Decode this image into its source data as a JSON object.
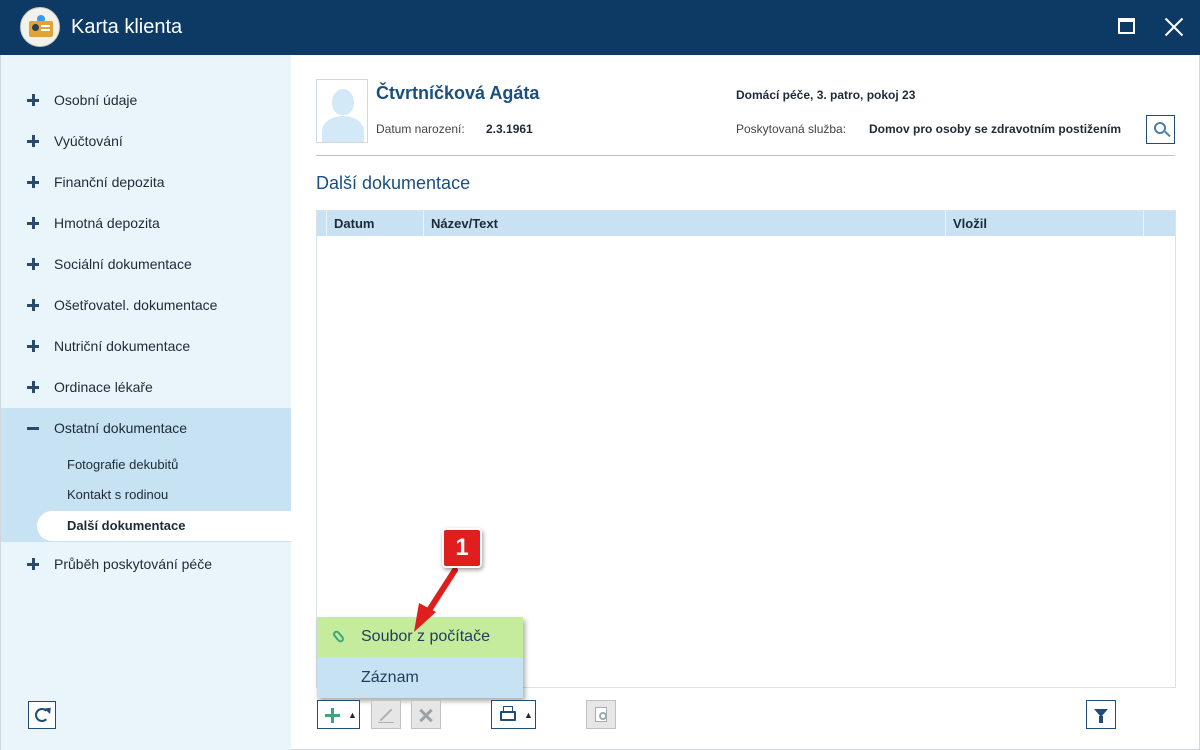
{
  "window": {
    "title": "Karta klienta"
  },
  "sidebar": {
    "items": [
      {
        "label": "Osobní údaje"
      },
      {
        "label": "Vyúčtování"
      },
      {
        "label": "Finanční depozita"
      },
      {
        "label": "Hmotná depozita"
      },
      {
        "label": "Sociální dokumentace"
      },
      {
        "label": "Ošetřovatel. dokumentace"
      },
      {
        "label": "Nutriční dokumentace"
      },
      {
        "label": "Ordinace lékaře"
      },
      {
        "label": "Ostatní dokumentace"
      },
      {
        "label": "Průběh poskytování péče"
      }
    ],
    "subitems": [
      {
        "label": "Fotografie dekubitů"
      },
      {
        "label": "Kontakt s rodinou"
      },
      {
        "label": "Další dokumentace"
      }
    ]
  },
  "client": {
    "name": "Čtvrtníčková Agáta",
    "birth_label": "Datum narození:",
    "birth_date": "2.3.1961",
    "location": "Domácí péče, 3. patro, pokoj 23",
    "service_label": "Poskytovaná služba:",
    "service_value": "Domov pro osoby se zdravotním postižením"
  },
  "section": {
    "title": "Další dokumentace"
  },
  "grid": {
    "columns": [
      "Datum",
      "Název/Text",
      "Vložil"
    ]
  },
  "popup_menu": {
    "items": [
      {
        "label": "Soubor z počítače"
      },
      {
        "label": "Záznam"
      }
    ]
  },
  "callout": {
    "number": "1"
  },
  "colors": {
    "titlebar": "#0d3a64",
    "sidebar_bg": "#eaf4fb",
    "accent": "#1b4f80",
    "highlight_green": "#c4ec9c",
    "callout_red": "#e01e1e"
  },
  "icons": {
    "app": "client-card-icon",
    "add": "plus-icon",
    "edit": "pencil-icon",
    "delete": "x-icon",
    "print": "printer-icon",
    "preview": "print-preview-icon",
    "filter": "funnel-icon",
    "refresh": "refresh-icon",
    "search": "magnifier-icon",
    "attach": "paperclip-icon"
  }
}
